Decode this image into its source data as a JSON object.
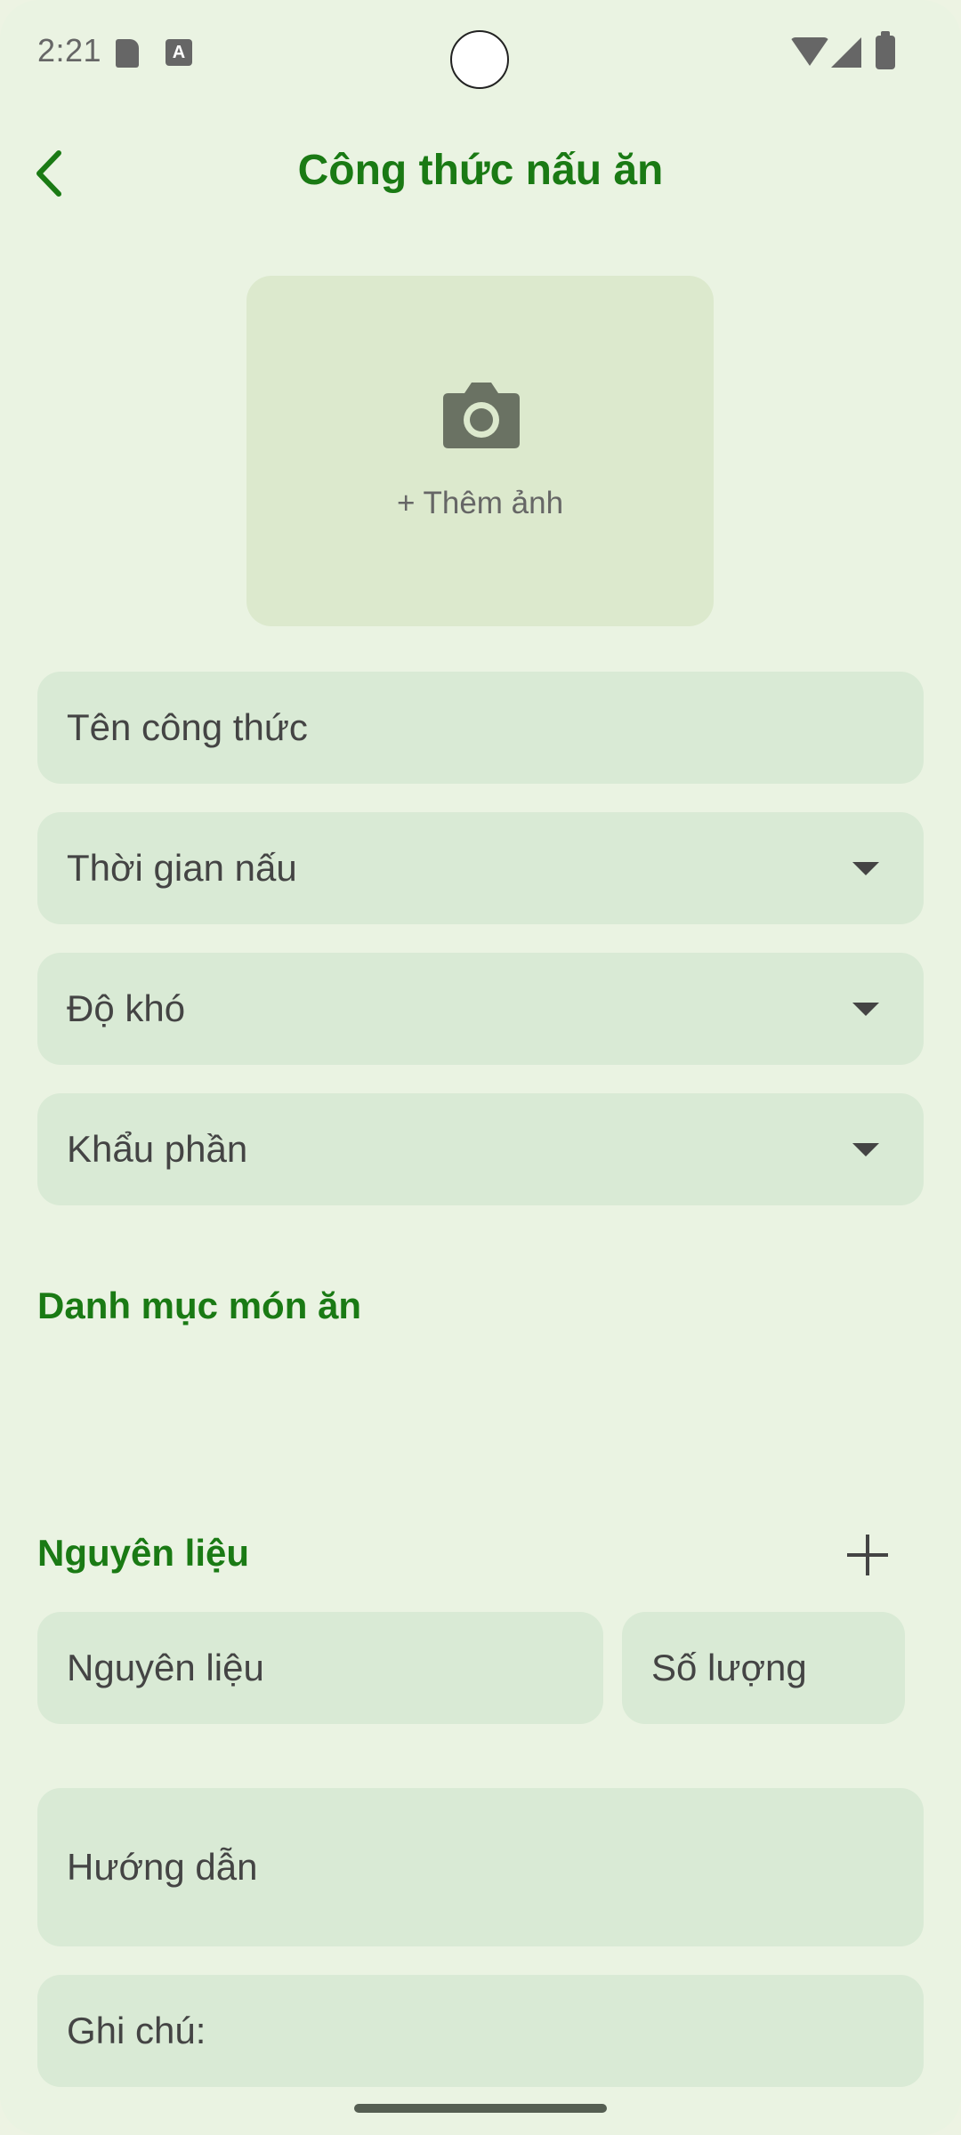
{
  "status_bar": {
    "time": "2:21",
    "a_badge": "A"
  },
  "app_bar": {
    "title": "Công thức nấu ăn",
    "back_icon": "chevron-left-icon"
  },
  "photo": {
    "icon": "camera-icon",
    "label": "+ Thêm ảnh"
  },
  "fields": {
    "recipe_name": "Tên công thức",
    "cook_time": "Thời gian nấu",
    "difficulty": "Độ khó",
    "servings": "Khẩu phần"
  },
  "sections": {
    "category": "Danh mục món ăn",
    "ingredients": "Nguyên liệu"
  },
  "ingredient_row": {
    "name_placeholder": "Nguyên liệu",
    "amount_placeholder": "Số lượng"
  },
  "instructions": "Hướng dẫn",
  "notes": "Ghi chú:",
  "colors": {
    "accent": "#1a7a14",
    "background": "#eaf3e2",
    "field": "#d9ead5",
    "photo_box": "#dce9cd"
  }
}
